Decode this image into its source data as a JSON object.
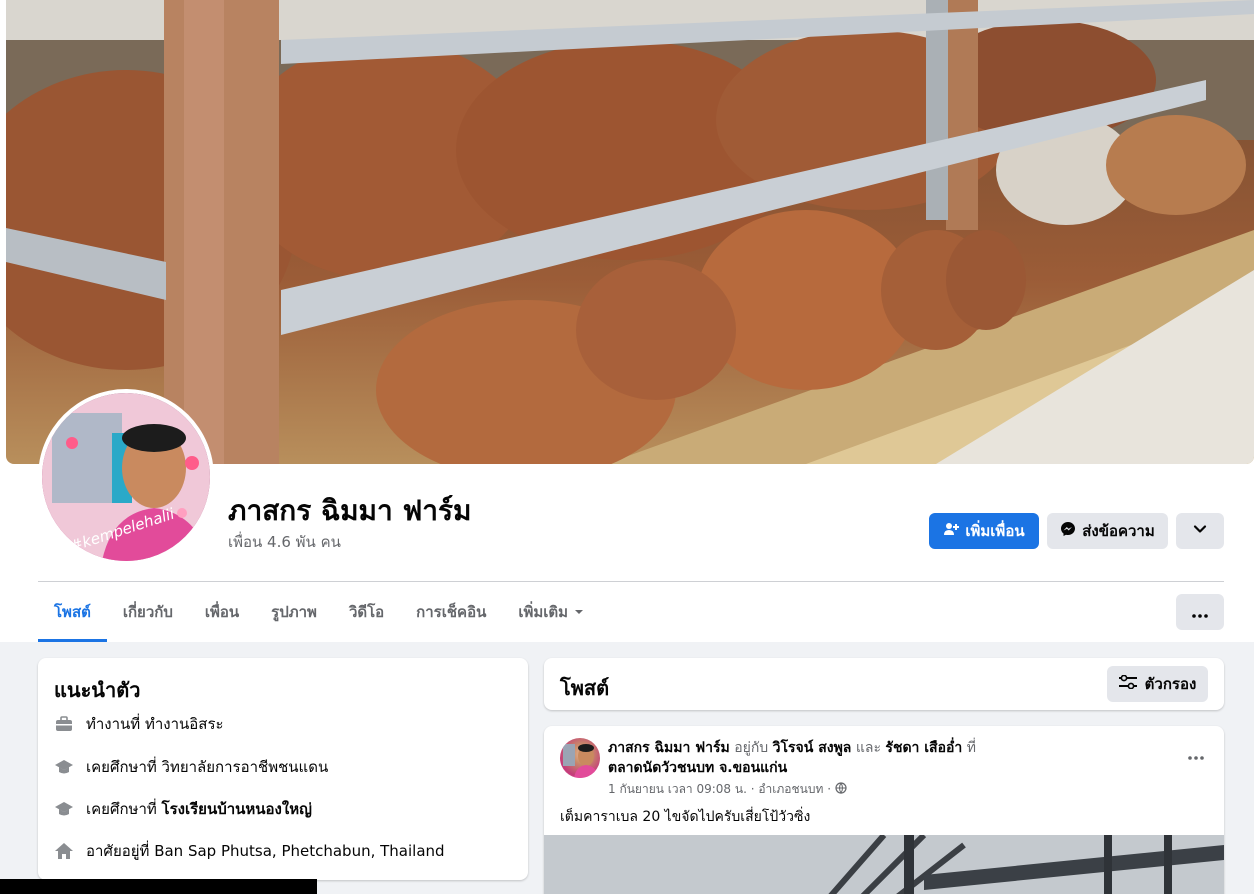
{
  "profile": {
    "name": "ภาสกร ฉิมมา ฟาร์ม",
    "friends": "เพื่อน 4.6 พัน คน"
  },
  "actions": {
    "add_friend": "เพิ่มเพื่อน",
    "message": "ส่งข้อความ"
  },
  "tabs": [
    {
      "label": "โพสต์"
    },
    {
      "label": "เกี่ยวกับ"
    },
    {
      "label": "เพื่อน"
    },
    {
      "label": "รูปภาพ"
    },
    {
      "label": "วิดีโอ"
    },
    {
      "label": "การเช็คอิน"
    },
    {
      "label": "เพิ่มเติม"
    }
  ],
  "intro": {
    "title": "แนะนำตัว",
    "items": [
      {
        "prefix": "ทำงานที่ ",
        "value": "ทำงานอิสระ",
        "bold": false
      },
      {
        "prefix": "เคยศึกษาที่ ",
        "value": "วิทยาลัยการอาชีพชนแดน",
        "bold": false
      },
      {
        "prefix": "เคยศึกษาที่ ",
        "value": "โรงเรียนบ้านหนองใหญ่",
        "bold": true
      },
      {
        "prefix": "อาศัยอยู่ที่ ",
        "value": "Ban Sap Phutsa, Phetchabun, Thailand",
        "bold": false
      }
    ]
  },
  "posts_header": {
    "title": "โพสต์",
    "filter": "ตัวกรอง"
  },
  "post": {
    "author": "ภาสกร ฉิมมา ฟาร์ม",
    "with_text": " อยู่กับ ",
    "tag1": "วิโรจน์ สงพูล",
    "and_text": " และ ",
    "tag2": "รัชดา เสืออ่ำ",
    "at_text": " ที่",
    "location": "ตลาดนัดวัวชนบท จ.ขอนแก่น",
    "time": "1 กันยายน เวลา 09:08 น. · อำเภอชนบท ·",
    "text": "เต็มคาราเบล 20 ไขจัดไปครับเสี่ยโป้วัวซิ่ง"
  },
  "avatar_caption": "#kempelehalii",
  "colors": {
    "accent": "#1b74e4",
    "secondary_btn": "#e4e6eb",
    "text_muted": "#65676b"
  }
}
